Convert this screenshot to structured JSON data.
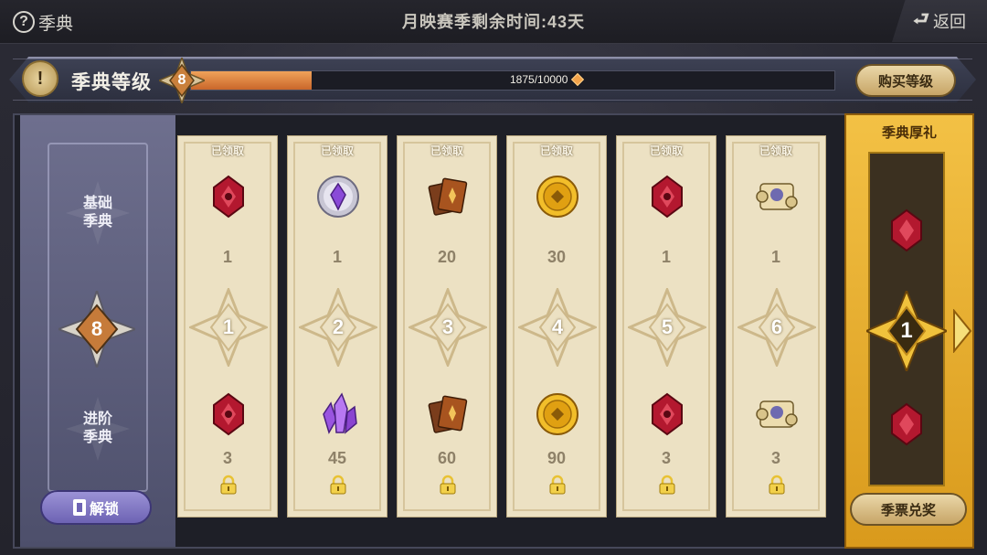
{
  "topbar": {
    "help_label": "季典",
    "season_time_text": "月映赛季剩余时间:43天",
    "back_label": "返回"
  },
  "level_bar": {
    "title": "季典等级",
    "current_level": "8",
    "progress_text": "1875/10000",
    "progress_fraction": 0.1875,
    "buy_label": "购买等级"
  },
  "sidebar": {
    "basic_tier": "基础\n季典",
    "advanced_tier": "进阶\n季典",
    "current_level": "8",
    "unlock_label": "解锁"
  },
  "columns": [
    {
      "claimed": "已领取",
      "level": "1",
      "basic_qty": "1",
      "basic_icon": "red-gem-icon",
      "adv_qty": "3",
      "adv_icon": "red-gem-icon"
    },
    {
      "claimed": "已领取",
      "level": "2",
      "basic_qty": "1",
      "basic_icon": "purple-crystal-coin-icon",
      "adv_qty": "45",
      "adv_icon": "purple-crystal-icon"
    },
    {
      "claimed": "已领取",
      "level": "3",
      "basic_qty": "20",
      "basic_icon": "cards-icon",
      "adv_qty": "60",
      "adv_icon": "cards-icon"
    },
    {
      "claimed": "已领取",
      "level": "4",
      "basic_qty": "30",
      "basic_icon": "gold-coin-icon",
      "adv_qty": "90",
      "adv_icon": "gold-coin-icon"
    },
    {
      "claimed": "已领取",
      "level": "5",
      "basic_qty": "1",
      "basic_icon": "red-gem-icon",
      "adv_qty": "3",
      "adv_icon": "red-gem-icon"
    },
    {
      "claimed": "已领取",
      "level": "6",
      "basic_qty": "1",
      "basic_icon": "scroll-icon",
      "adv_qty": "3",
      "adv_icon": "scroll-icon"
    }
  ],
  "gold_panel": {
    "title": "季典厚礼",
    "level": "1",
    "redeem_label": "季票兑奖"
  },
  "colors": {
    "progress_fill": "#e0843f",
    "column_bg": "#ece1c3",
    "gold_panel": "#f3c145",
    "sidebar": "#6e6f8e"
  }
}
